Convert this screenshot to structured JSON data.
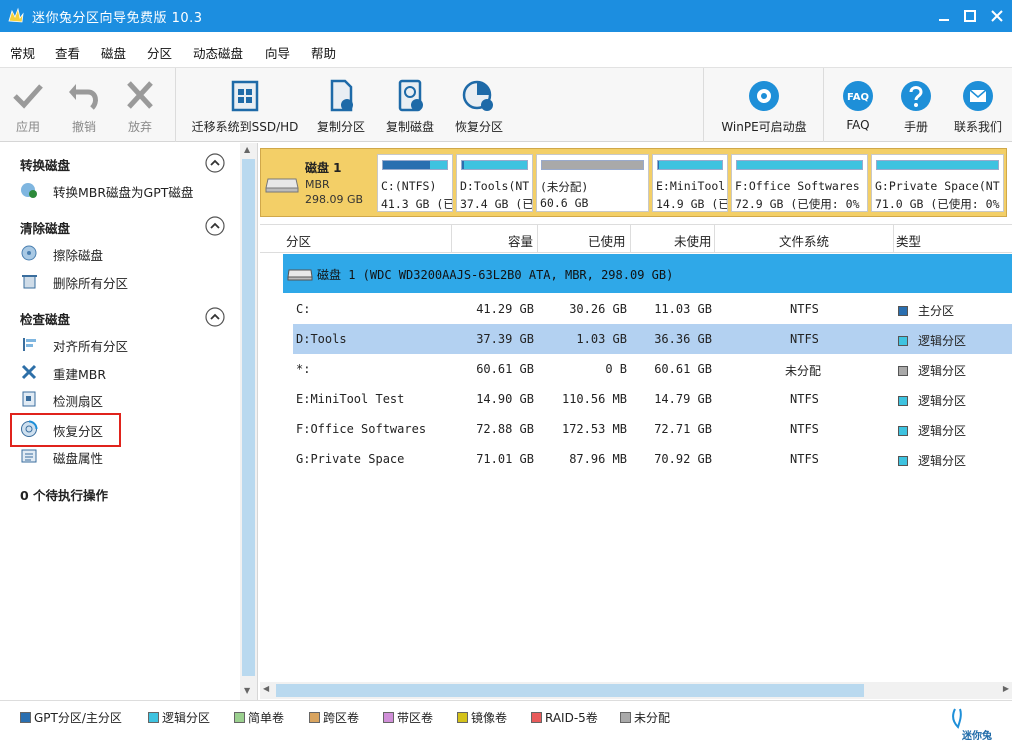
{
  "window": {
    "title": "迷你兔分区向导免费版 10.3"
  },
  "menu": [
    "常规",
    "查看",
    "磁盘",
    "分区",
    "动态磁盘",
    "向导",
    "帮助"
  ],
  "toolbar": {
    "apply": "应用",
    "undo": "撤销",
    "discard": "放弃",
    "migrate": "迁移系统到SSD/HD",
    "copy_partition": "复制分区",
    "copy_disk": "复制磁盘",
    "recover_partition": "恢复分区",
    "winpe": "WinPE可启动盘",
    "faq": "FAQ",
    "manual": "手册",
    "contact": "联系我们",
    "faq_icon_text": "FAQ"
  },
  "sidebar": {
    "convert_title": "转换磁盘",
    "convert_items": [
      "转换MBR磁盘为GPT磁盘"
    ],
    "clean_title": "清除磁盘",
    "clean_items": [
      "擦除磁盘",
      "删除所有分区"
    ],
    "check_title": "检查磁盘",
    "check_items": [
      "对齐所有分区",
      "重建MBR",
      "检测扇区",
      "恢复分区",
      "磁盘属性"
    ],
    "pending": "0 个待执行操作"
  },
  "diskmap": {
    "name": "磁盘 1",
    "type": "MBR",
    "size": "298.09 GB",
    "partitions": [
      {
        "l1": "C:(NTFS)",
        "l2": "41.3 GB (已",
        "used_fraction": 0.73,
        "bar": "#3ec3e0"
      },
      {
        "l1": "D:Tools(NT",
        "l2": "37.4 GB (已",
        "used_fraction": 0.03,
        "bar": "#3ec3e0"
      },
      {
        "l1": "(未分配)",
        "l2": "60.6 GB",
        "used_fraction": 0,
        "bar": "#a9a9a9"
      },
      {
        "l1": "E:MiniTool",
        "l2": "14.9 GB (已",
        "used_fraction": 0.01,
        "bar": "#3ec3e0"
      },
      {
        "l1": "F:Office Softwares",
        "l2": "72.9 GB (已使用: 0%",
        "used_fraction": 0.0,
        "bar": "#3ec3e0"
      },
      {
        "l1": "G:Private Space(NT",
        "l2": "71.0 GB (已使用: 0%",
        "used_fraction": 0.0,
        "bar": "#3ec3e0"
      }
    ]
  },
  "table": {
    "headers": [
      "分区",
      "容量",
      "已使用",
      "未使用",
      "文件系统",
      "类型"
    ],
    "disk_row": "磁盘 1 (WDC WD3200AAJS-63L2B0 ATA, MBR, 298.09 GB)",
    "rows": [
      {
        "name": "C:",
        "capacity": "41.29 GB",
        "used": "30.26 GB",
        "unused": "11.03 GB",
        "fs": "NTFS",
        "type": "主分区",
        "color": "#2a6fb0"
      },
      {
        "name": "D:Tools",
        "capacity": "37.39 GB",
        "used": "1.03 GB",
        "unused": "36.36 GB",
        "fs": "NTFS",
        "type": "逻辑分区",
        "color": "#3ec3e0"
      },
      {
        "name": "*:",
        "capacity": "60.61 GB",
        "used": "0 B",
        "unused": "60.61 GB",
        "fs": "未分配",
        "type": "逻辑分区",
        "color": "#a9a9a9"
      },
      {
        "name": "E:MiniTool Test",
        "capacity": "14.90 GB",
        "used": "110.56 MB",
        "unused": "14.79 GB",
        "fs": "NTFS",
        "type": "逻辑分区",
        "color": "#3ec3e0"
      },
      {
        "name": "F:Office Softwares",
        "capacity": "72.88 GB",
        "used": "172.53 MB",
        "unused": "72.71 GB",
        "fs": "NTFS",
        "type": "逻辑分区",
        "color": "#3ec3e0"
      },
      {
        "name": "G:Private Space",
        "capacity": "71.01 GB",
        "used": "87.96 MB",
        "unused": "70.92 GB",
        "fs": "NTFS",
        "type": "逻辑分区",
        "color": "#3ec3e0"
      }
    ]
  },
  "legend": [
    {
      "label": "GPT分区/主分区",
      "color": "#2a6fb0"
    },
    {
      "label": "逻辑分区",
      "color": "#3ec3e0"
    },
    {
      "label": "简单卷",
      "color": "#9bd08f"
    },
    {
      "label": "跨区卷",
      "color": "#d9a45f"
    },
    {
      "label": "带区卷",
      "color": "#d08fd8"
    },
    {
      "label": "镜像卷",
      "color": "#d4c21a"
    },
    {
      "label": "RAID-5卷",
      "color": "#e85b5b"
    },
    {
      "label": "未分配",
      "color": "#a9a9a9"
    }
  ],
  "brand": "迷你兔"
}
